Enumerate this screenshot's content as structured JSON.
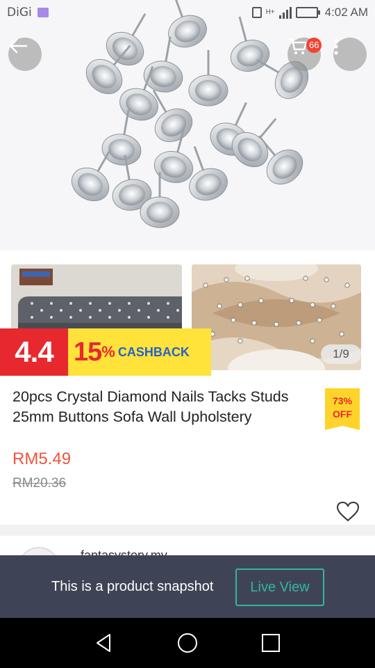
{
  "status_bar": {
    "carrier": "DiGi",
    "network": "H+",
    "time": "4:02 AM",
    "battery_level": 1.0
  },
  "header": {
    "back_icon": "arrow-left-icon",
    "cart_icon": "shopping-cart-icon",
    "cart_count": "66",
    "more_icon": "vertical-dots-icon"
  },
  "gallery": {
    "page_indicator": "1/9"
  },
  "promo": {
    "date": "4.4",
    "percent": "15",
    "percent_sign": "%",
    "label": "CASHBACK"
  },
  "product": {
    "title": "20pcs Crystal Diamond Nails Tacks Studs 25mm Buttons Sofa Wall Upholstery",
    "discount_pct": "73%",
    "discount_label": "OFF",
    "price": "RM5.49",
    "original_price": "RM20.36"
  },
  "seller": {
    "name": "fantasystory.my"
  },
  "snapshot": {
    "message": "This is a product snapshot",
    "button_label": "Live View"
  },
  "colors": {
    "accent_red": "#e8282f",
    "price_orange": "#f0543c",
    "promo_yellow": "#ffe23a",
    "live_view_teal": "#33b5a4",
    "banner_bg": "#3e4456"
  }
}
